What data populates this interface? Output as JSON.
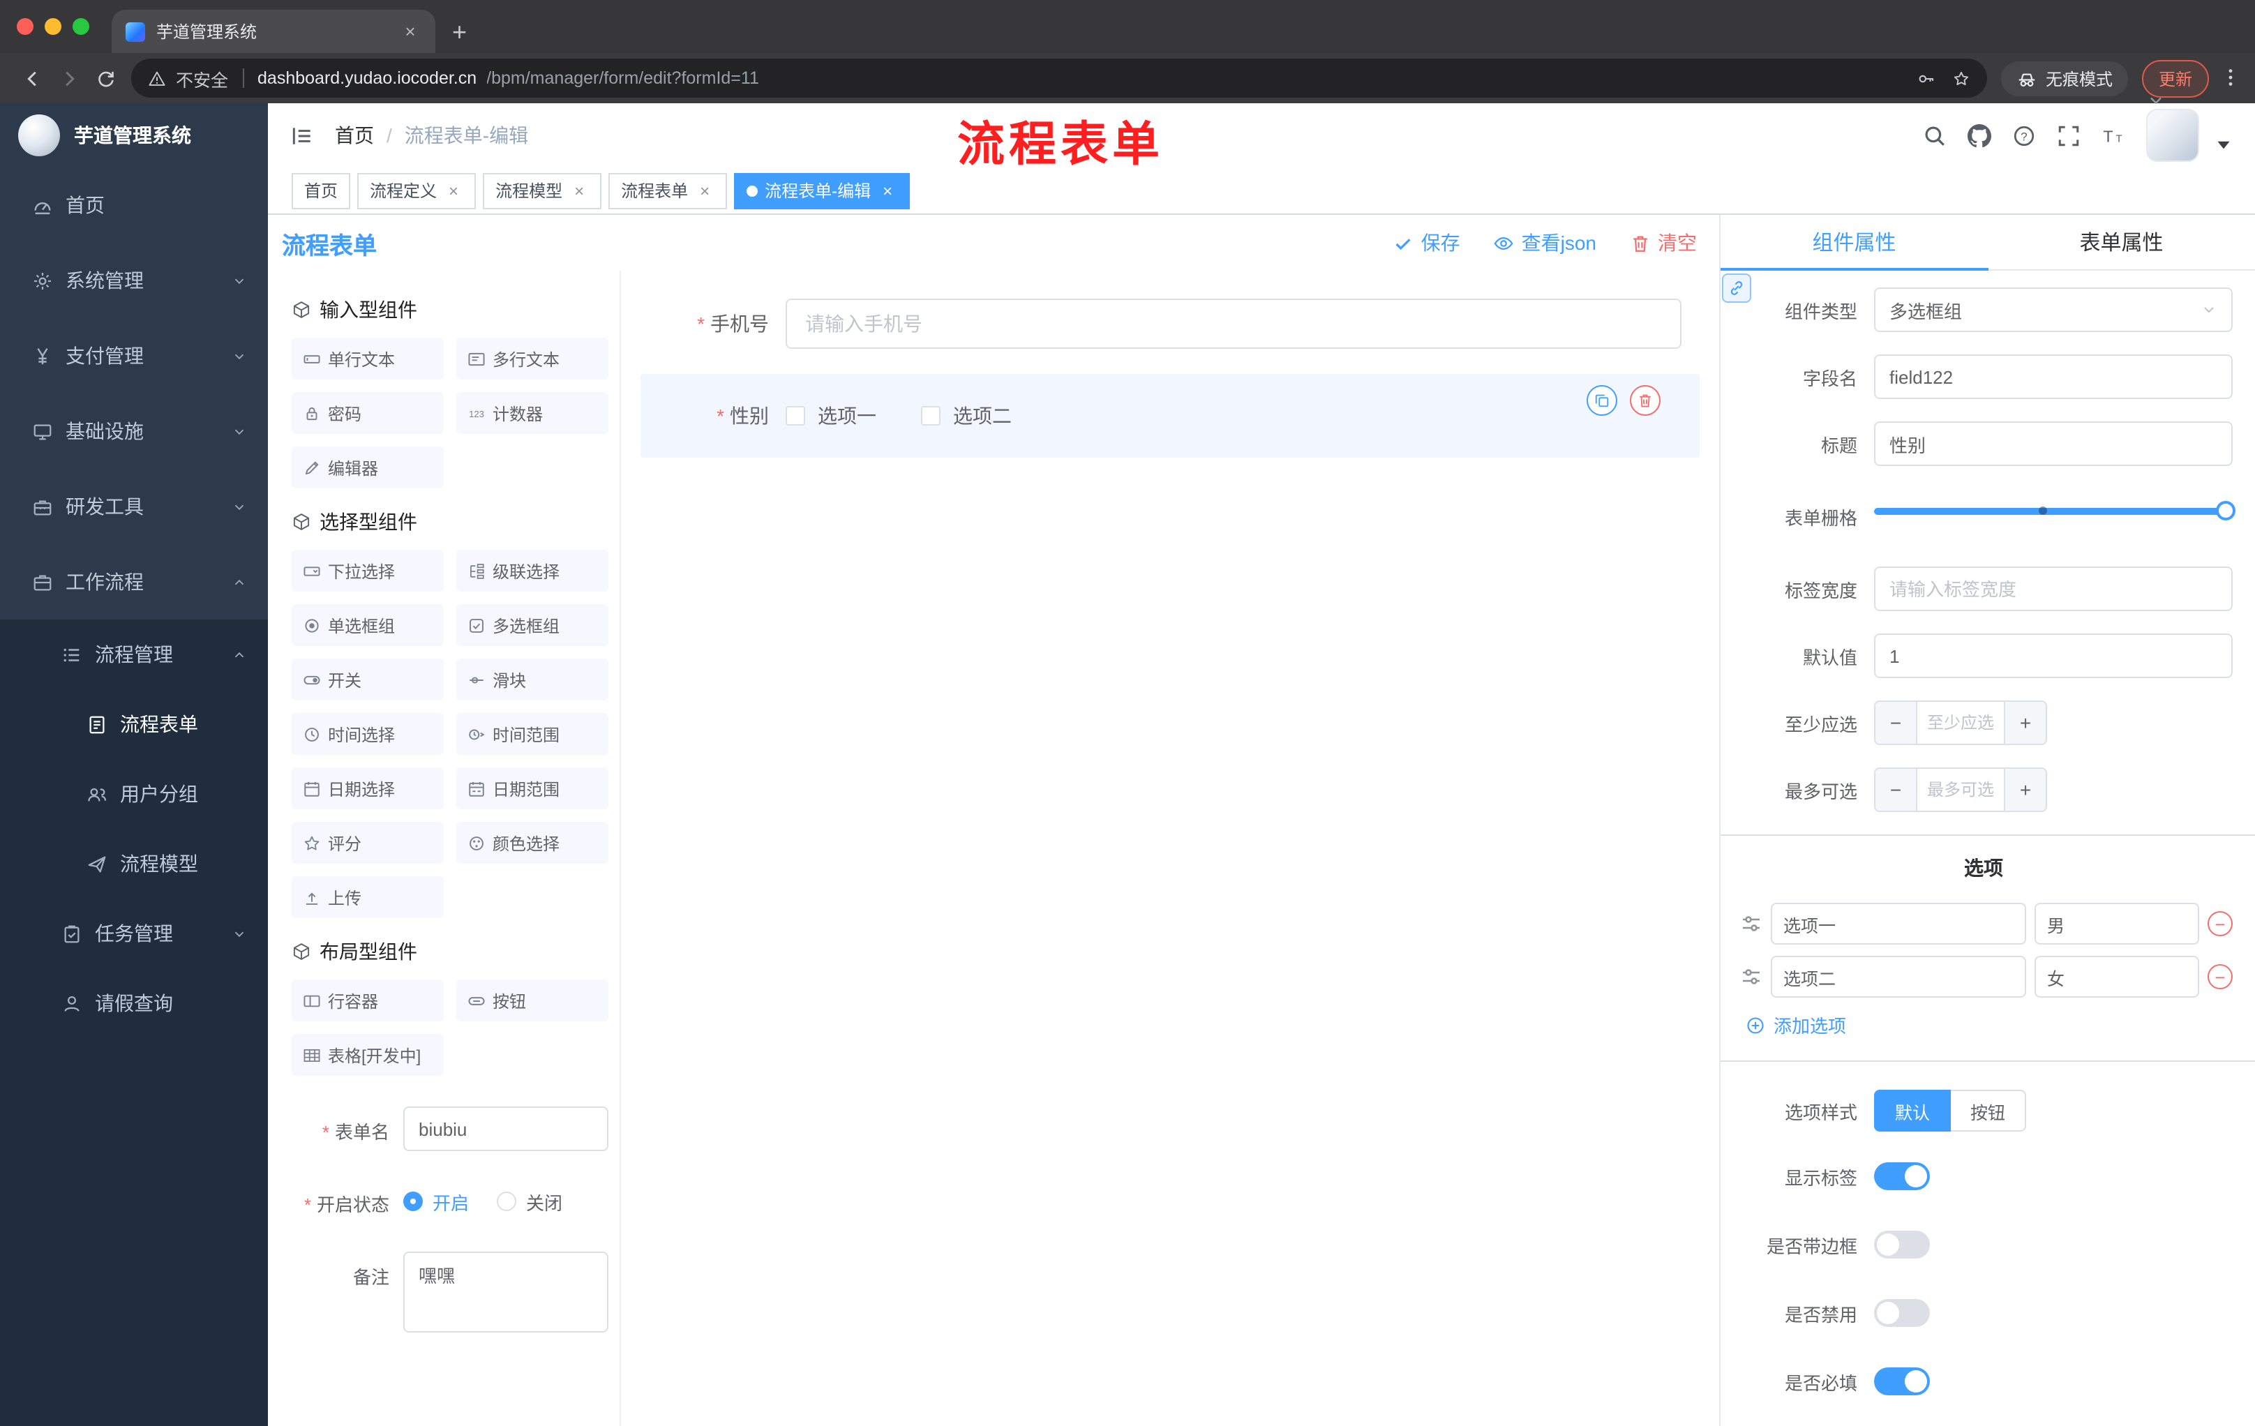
{
  "browser": {
    "tab_title": "芋道管理系统",
    "url_security": "不安全",
    "url_host": "dashboard.yudao.iocoder.cn",
    "url_path": "/bpm/manager/form/edit?formId=11",
    "incognito_label": "无痕模式",
    "update_label": "更新"
  },
  "header": {
    "breadcrumb": [
      "首页",
      "流程表单-编辑"
    ],
    "breadcrumb_separator": "/",
    "watermark": "流程表单"
  },
  "tags": [
    {
      "key": "home",
      "label": "首页",
      "closable": false,
      "active": false
    },
    {
      "key": "process-definition",
      "label": "流程定义",
      "closable": true,
      "active": false
    },
    {
      "key": "process-model",
      "label": "流程模型",
      "closable": true,
      "active": false
    },
    {
      "key": "process-form",
      "label": "流程表单",
      "closable": true,
      "active": false
    },
    {
      "key": "process-form-edit",
      "label": "流程表单-编辑",
      "closable": true,
      "active": true
    }
  ],
  "sidebar": {
    "logo_title": "芋道管理系统",
    "menu": [
      {
        "key": "home",
        "label": "首页",
        "icon": "gauge",
        "level": 1
      },
      {
        "key": "system-mgmt",
        "label": "系统管理",
        "icon": "gear",
        "level": 1,
        "arrow": "down"
      },
      {
        "key": "payment-mgmt",
        "label": "支付管理",
        "icon": "yen",
        "level": 1,
        "arrow": "down"
      },
      {
        "key": "infrastructure",
        "label": "基础设施",
        "icon": "monitor",
        "level": 1,
        "arrow": "down"
      },
      {
        "key": "dev-tools",
        "label": "研发工具",
        "icon": "toolbox",
        "level": 1,
        "arrow": "down"
      },
      {
        "key": "workflow",
        "label": "工作流程",
        "icon": "briefcase",
        "level": 1,
        "arrow": "up"
      },
      {
        "key": "process-mgmt",
        "label": "流程管理",
        "icon": "list",
        "level": 2,
        "arrow": "up",
        "sub": true
      },
      {
        "key": "process-form",
        "label": "流程表单",
        "icon": "form",
        "level": 3,
        "active": true,
        "sub": true
      },
      {
        "key": "user-group",
        "label": "用户分组",
        "icon": "people",
        "level": 3,
        "sub": true
      },
      {
        "key": "process-model",
        "label": "流程模型",
        "icon": "send",
        "level": 3,
        "sub": true
      },
      {
        "key": "task-mgmt",
        "label": "任务管理",
        "icon": "tasks",
        "level": 2,
        "arrow": "down",
        "sub": true
      },
      {
        "key": "leave-query",
        "label": "请假查询",
        "icon": "person",
        "level": 2,
        "sub": true
      }
    ]
  },
  "editor": {
    "title": "流程表单",
    "actions": {
      "save": "保存",
      "view_json": "查看json",
      "clear": "清空"
    }
  },
  "palette": {
    "sections": [
      {
        "title": "输入型组件",
        "items": [
          {
            "icon": "input",
            "label": "单行文本"
          },
          {
            "icon": "textarea",
            "label": "多行文本"
          },
          {
            "icon": "lock",
            "label": "密码"
          },
          {
            "icon": "counter",
            "label": "计数器"
          },
          {
            "icon": "editor",
            "label": "编辑器"
          }
        ]
      },
      {
        "title": "选择型组件",
        "items": [
          {
            "icon": "select",
            "label": "下拉选择"
          },
          {
            "icon": "cascader",
            "label": "级联选择"
          },
          {
            "icon": "radio",
            "label": "单选框组"
          },
          {
            "icon": "checkbox",
            "label": "多选框组"
          },
          {
            "icon": "switch",
            "label": "开关"
          },
          {
            "icon": "slider",
            "label": "滑块"
          },
          {
            "icon": "time",
            "label": "时间选择"
          },
          {
            "icon": "time-range",
            "label": "时间范围"
          },
          {
            "icon": "date",
            "label": "日期选择"
          },
          {
            "icon": "date-range",
            "label": "日期范围"
          },
          {
            "icon": "rate",
            "label": "评分"
          },
          {
            "icon": "color",
            "label": "颜色选择"
          },
          {
            "icon": "upload",
            "label": "上传"
          }
        ]
      },
      {
        "title": "布局型组件",
        "items": [
          {
            "icon": "row",
            "label": "行容器"
          },
          {
            "icon": "button",
            "label": "按钮"
          },
          {
            "icon": "table",
            "label": "表格[开发中]"
          }
        ]
      }
    ],
    "form": {
      "name_label": "表单名",
      "name_value": "biubiu",
      "status_label": "开启状态",
      "status_options": [
        "开启",
        "关闭"
      ],
      "status_selected": "开启",
      "remark_label": "备注",
      "remark_value": "嘿嘿"
    }
  },
  "canvas": {
    "fields": [
      {
        "label": "手机号",
        "required": true,
        "type": "input",
        "placeholder": "请输入手机号"
      },
      {
        "label": "性别",
        "required": true,
        "type": "checkbox-group",
        "options": [
          "选项一",
          "选项二"
        ],
        "selected": true
      }
    ]
  },
  "props_panel": {
    "tabs": [
      "组件属性",
      "表单属性"
    ],
    "active_tab": "组件属性",
    "fields": {
      "component_type_label": "组件类型",
      "component_type_value": "多选框组",
      "field_name_label": "字段名",
      "field_name_value": "field122",
      "title_label": "标题",
      "title_value": "性别",
      "grid_label": "表单栅格",
      "label_width_label": "标签宽度",
      "label_width_placeholder": "请输入标签宽度",
      "default_label": "默认值",
      "default_value": "1",
      "min_label": "至少应选",
      "min_placeholder": "至少应选",
      "max_label": "最多可选",
      "max_placeholder": "最多可选"
    },
    "options_section": {
      "title": "选项",
      "options": [
        {
          "label": "选项一",
          "value": "男"
        },
        {
          "label": "选项二",
          "value": "女"
        }
      ],
      "add_label": "添加选项"
    },
    "style_section": {
      "label": "选项样式",
      "choices": [
        "默认",
        "按钮"
      ],
      "selected": "默认"
    },
    "toggles": [
      {
        "key": "show-label",
        "label": "显示标签",
        "on": true
      },
      {
        "key": "with-border",
        "label": "是否带边框",
        "on": false
      },
      {
        "key": "disabled",
        "label": "是否禁用",
        "on": false
      },
      {
        "key": "required",
        "label": "是否必填",
        "on": true
      }
    ]
  },
  "colors": {
    "accent": "#409eff",
    "danger": "#f56c6c",
    "watermark_red": "#fd1f1f",
    "sidebar_bg": "#2d3a4b",
    "sidebar_sub_bg": "#1f2d3d"
  }
}
